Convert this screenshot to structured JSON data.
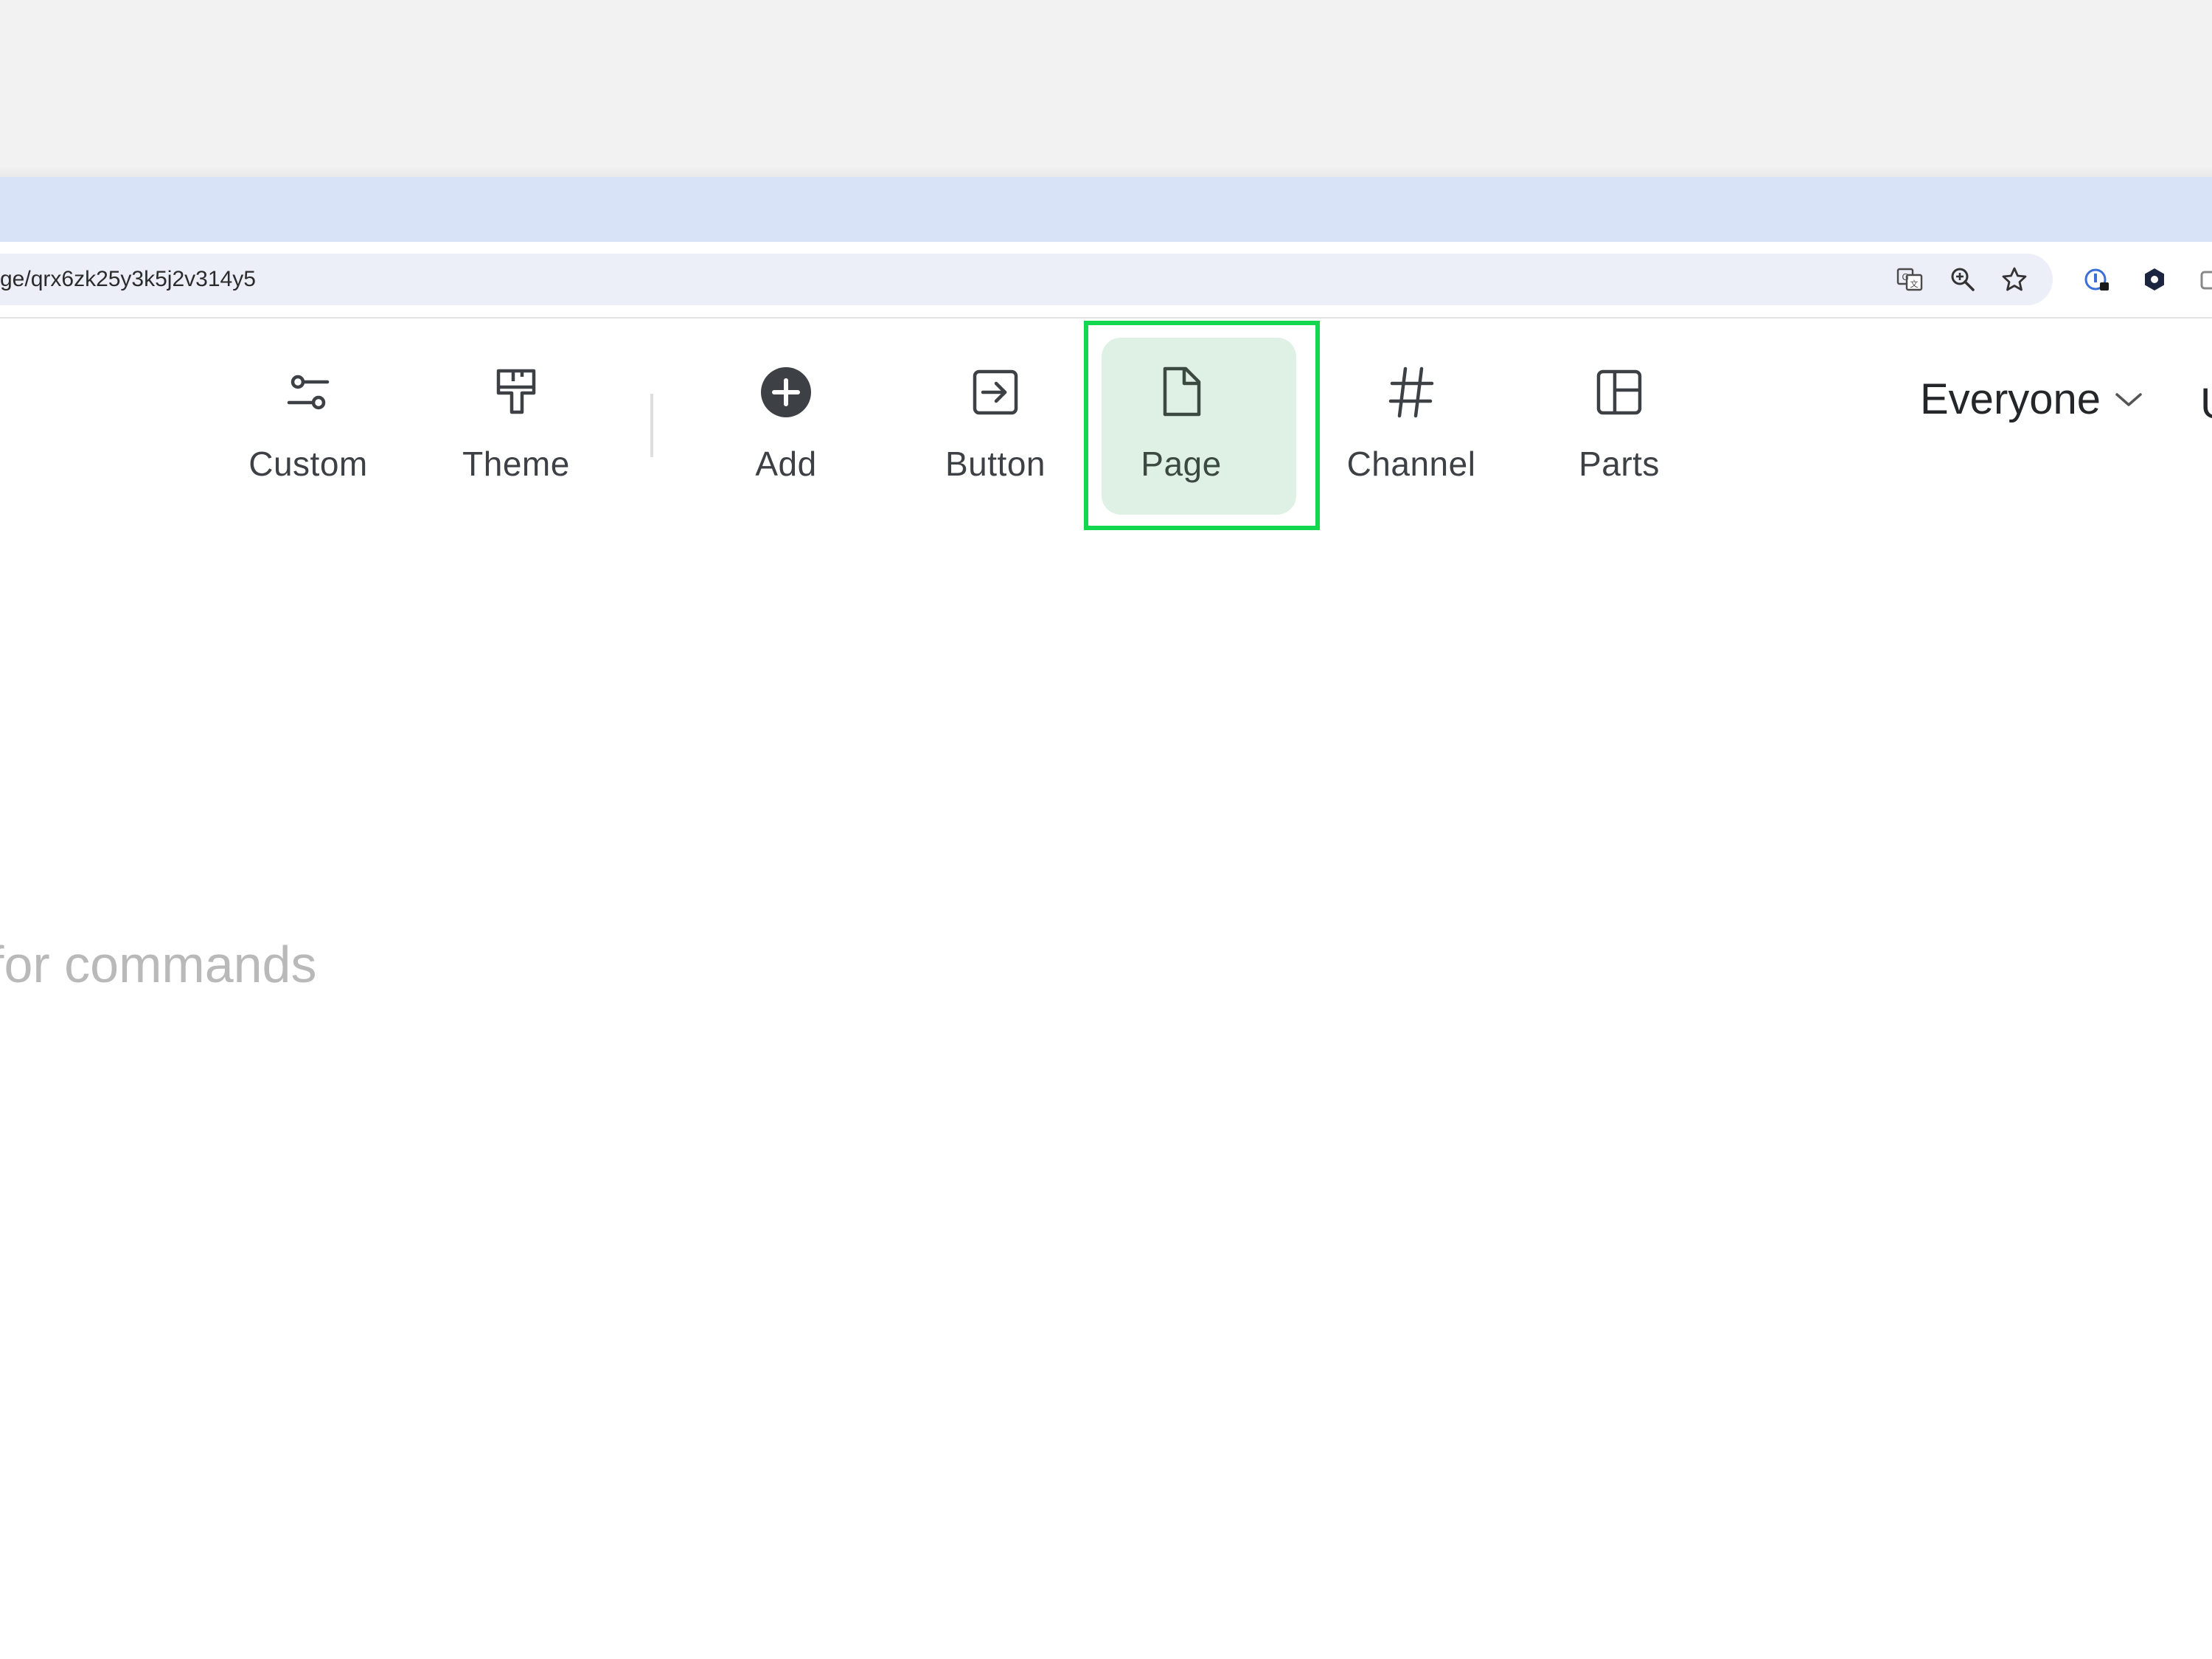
{
  "browser": {
    "url": "ge/qrx6zk25y3k5j2v314y5",
    "omnibox_icons": [
      "translate-icon",
      "zoom-icon",
      "bookmark-star-icon"
    ],
    "extension_icons": [
      "password-manager-icon",
      "extension-hex-icon",
      "extension-partial-icon"
    ]
  },
  "toolbar": {
    "items": [
      {
        "label": "Custom",
        "icon": "sliders-icon"
      },
      {
        "label": "Theme",
        "icon": "paint-roller-icon"
      },
      {
        "label": "Add",
        "icon": "plus-circle-icon"
      },
      {
        "label": "Button",
        "icon": "arrow-box-icon"
      },
      {
        "label": "Page",
        "icon": "page-icon",
        "active": true
      },
      {
        "label": "Channel",
        "icon": "hash-icon"
      },
      {
        "label": "Parts",
        "icon": "layout-icon"
      }
    ],
    "audience": "Everyone",
    "edge_glyph": "U"
  },
  "editor": {
    "placeholder": "for commands"
  },
  "colors": {
    "active_bg": "#dff1e4",
    "highlight": "#13d84f",
    "tabstrip": "#d8e3f8",
    "icon": "#3d4045"
  }
}
